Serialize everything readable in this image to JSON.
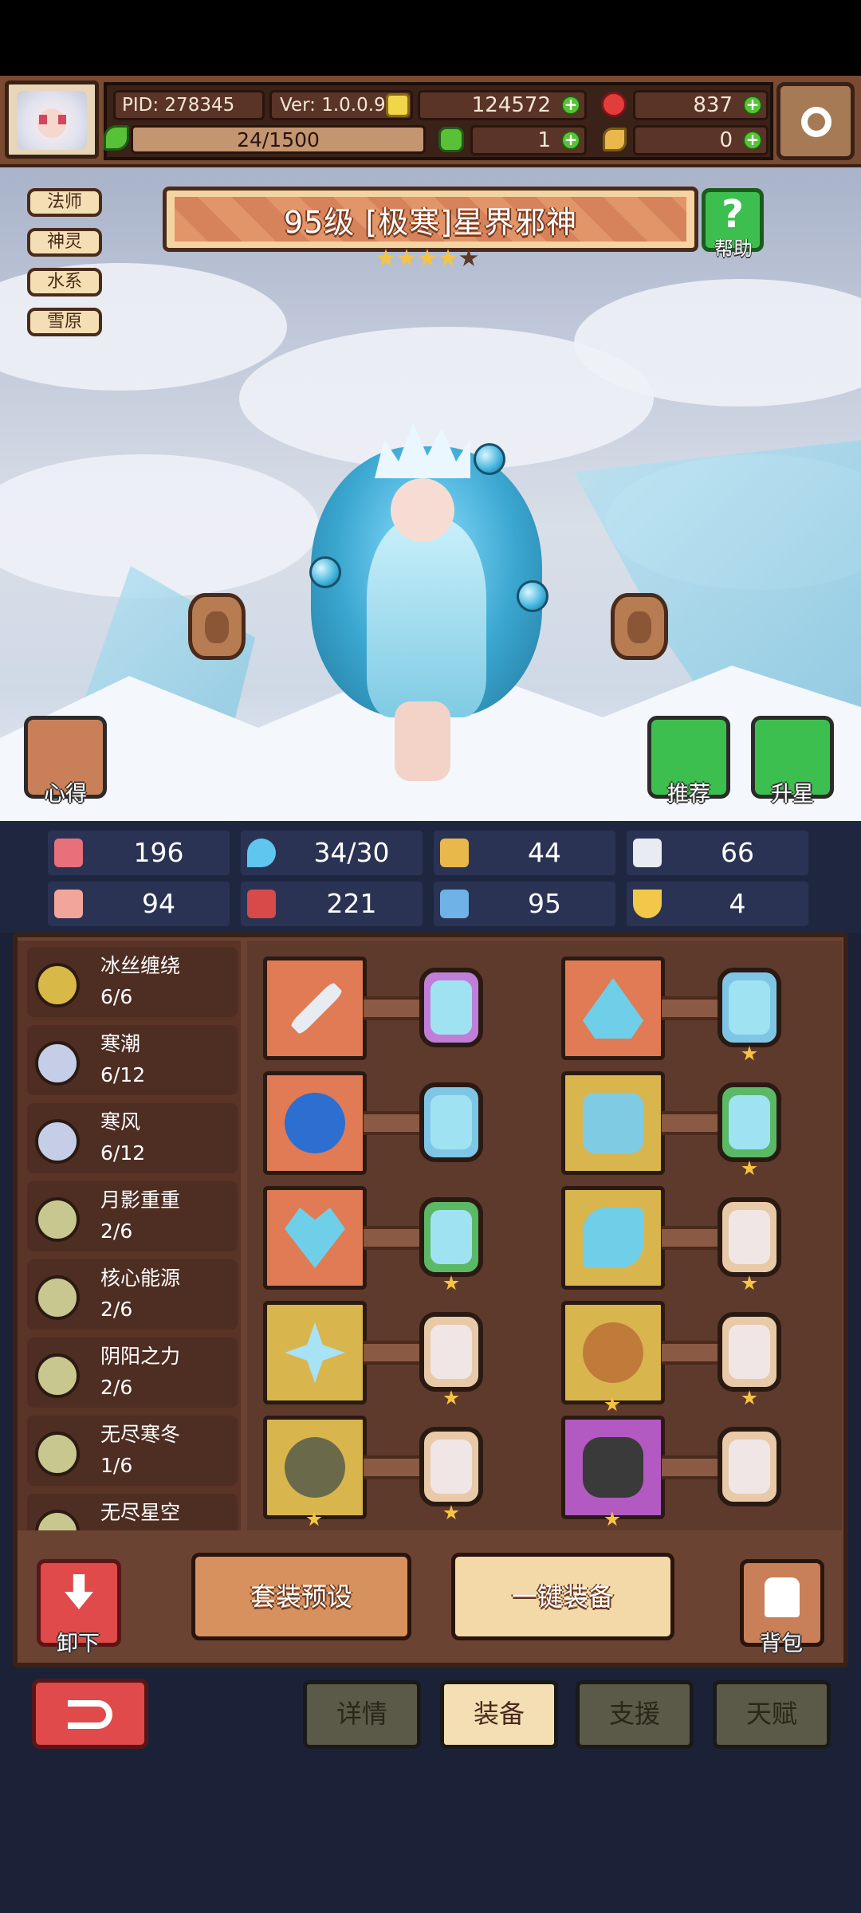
{
  "header": {
    "pid": "PID: 278345",
    "version": "Ver: 1.0.0.9",
    "gold": "124572",
    "gems": "837",
    "stamina": "24/1500",
    "clover": "1",
    "keys": "0"
  },
  "tags": [
    "法师",
    "神灵",
    "水系",
    "雪原"
  ],
  "hero": {
    "title": "95级 [极寒]星界邪神",
    "stars_filled": 4,
    "stars_total": 5
  },
  "scene_buttons": {
    "help": "帮助",
    "insight": "心得",
    "recommend": "推荐",
    "upgrade_star": "升星"
  },
  "stats": [
    {
      "icon": "heart-icon",
      "value": "196"
    },
    {
      "icon": "water-drop-icon",
      "value": "34/30"
    },
    {
      "icon": "shield-icon",
      "value": "44"
    },
    {
      "icon": "wing-icon",
      "value": "66"
    },
    {
      "icon": "fist-icon",
      "value": "94"
    },
    {
      "icon": "spellbook-icon",
      "value": "221"
    },
    {
      "icon": "boot-icon",
      "value": "95"
    },
    {
      "icon": "magnet-icon",
      "value": "4"
    }
  ],
  "sets": [
    {
      "name": "冰丝缠绕",
      "progress": "6/6"
    },
    {
      "name": "寒潮",
      "progress": "6/12"
    },
    {
      "name": "寒风",
      "progress": "6/12"
    },
    {
      "name": "月影重重",
      "progress": "2/6"
    },
    {
      "name": "核心能源",
      "progress": "2/6"
    },
    {
      "name": "阴阳之力",
      "progress": "2/6"
    },
    {
      "name": "无尽寒冬",
      "progress": "1/6"
    },
    {
      "name": "无尽星空",
      "progress": ""
    }
  ],
  "actions": {
    "unequip": "卸下",
    "set_preset": "套装预设",
    "one_click_equip": "一键装备",
    "backpack": "背包"
  },
  "tabs": [
    "详情",
    "装备",
    "支援",
    "天赋"
  ],
  "active_tab": "装备",
  "colors": {
    "accent_orange": "#e07b55",
    "panel_brown": "#6b4332",
    "green_button": "#3cbf4e",
    "red_button": "#e04a4a",
    "star_gold": "#f6c443"
  }
}
